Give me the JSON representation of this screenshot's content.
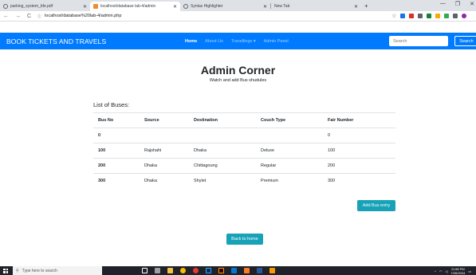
{
  "browser": {
    "tabs": [
      {
        "title": "parking_system_bfe.pdf",
        "active": false
      },
      {
        "title": "localhost/database lab-4/admin",
        "active": true
      },
      {
        "title": "Syntax Highlighter",
        "active": false
      },
      {
        "title": "New Tab",
        "active": false
      }
    ],
    "url": "localhost/database%20lab-4/admin.php"
  },
  "navbar": {
    "brand": "BOOK TICKETS AND TRAVELS",
    "links": [
      "Home",
      "About Us",
      "Travellings ▾",
      "Admin Panel"
    ],
    "search_placeholder": "Search",
    "search_button": "Search"
  },
  "header": {
    "title": "Admin Corner",
    "subtitle": "Watch and add Bus shudules"
  },
  "buses": {
    "list_title": "List of Buses:",
    "columns": [
      "Bus No",
      "Source",
      "Destination",
      "Couch Type",
      "Fair Number"
    ],
    "rows": [
      [
        "0",
        "",
        "",
        "",
        "0"
      ],
      [
        "100",
        "Rajshahi",
        "Dhaka",
        "Deluxe",
        "100"
      ],
      [
        "200",
        "Dhaka",
        "Chittagoung",
        "Regular",
        "200"
      ],
      [
        "300",
        "Dhaka",
        "Shylet",
        "Premium",
        "300"
      ]
    ],
    "add_button": "Add Bus entry",
    "home_button": "Back to home"
  },
  "taskbar": {
    "search_placeholder": "Type here to search",
    "time": "11:58 PM",
    "date": "7/26/2024"
  },
  "colors": {
    "navbar": "#007bff",
    "button": "#17a2b8"
  }
}
